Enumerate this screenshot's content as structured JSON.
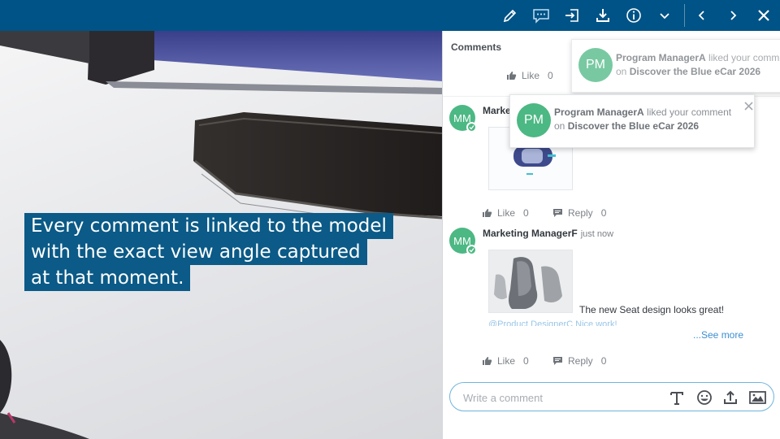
{
  "colors": {
    "toolbar": "#005386",
    "caption": "#0b5a87",
    "avatar": "#4cb883",
    "link": "#3d8fd0"
  },
  "toolbar": {
    "icons": [
      "pencil-icon",
      "comment-icon",
      "import-icon",
      "download-icon",
      "info-icon",
      "chevron-down-icon",
      "previous-icon",
      "next-icon",
      "close-icon"
    ]
  },
  "viewport": {
    "caption_lines": [
      "Every comment is linked to the model",
      "with the exact view angle captured",
      "at that moment."
    ]
  },
  "panel": {
    "title": "Comments",
    "comments": [
      {
        "initials": "MM",
        "author": "Marke",
        "like_label": "Like",
        "like_count": "0",
        "reply_label": "Reply",
        "reply_count": "0"
      },
      {
        "initials": "MM",
        "author": "Marketing ManagerF",
        "time": "just now",
        "text": "The new Seat design looks great!",
        "mention": "@Product DesignerC Nice work!",
        "see_more": "...See more",
        "like_label": "Like",
        "like_count": "0",
        "reply_label": "Reply",
        "reply_count": "0"
      }
    ],
    "top_like": {
      "label": "Like",
      "count": "0"
    },
    "input": {
      "placeholder": "Write a comment"
    }
  },
  "notifications": [
    {
      "initials": "PM",
      "actor": "Program ManagerA",
      "action": " liked your comm",
      "prefix": "on ",
      "target": "Discover the Blue eCar 2026"
    },
    {
      "initials": "PM",
      "actor": "Program ManagerA",
      "action": " liked your comment",
      "prefix": "on ",
      "target": "Discover the Blue eCar 2026"
    }
  ]
}
